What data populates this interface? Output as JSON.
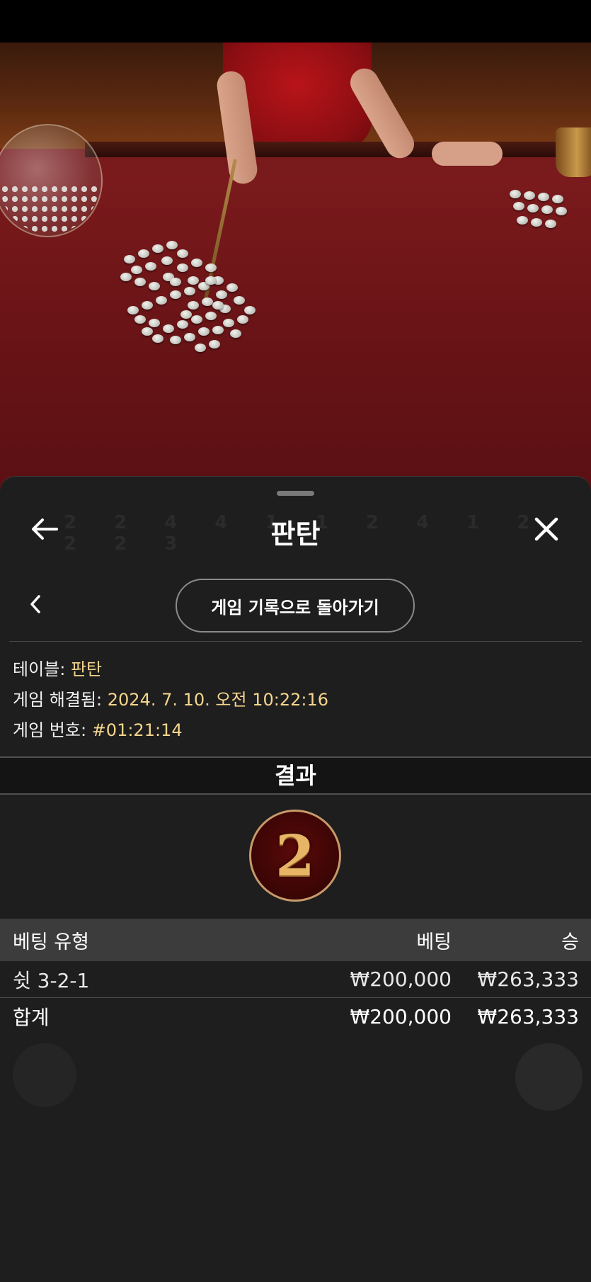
{
  "sheet": {
    "title": "판탄",
    "back_to_history_label": "게임 기록으로 돌아가기"
  },
  "info": {
    "table_label": "테이블:",
    "table_value": "판탄",
    "resolved_label": "게임 해결됨:",
    "resolved_value": "2024. 7. 10. 오전 10:22:16",
    "game_no_label": "게임 번호:",
    "game_no_value": "#01:21:14"
  },
  "result": {
    "heading": "결과",
    "value": "2"
  },
  "bets": {
    "columns": [
      "베팅 유형",
      "베팅",
      "승"
    ],
    "rows": [
      {
        "type": "쉿 3-2-1",
        "bet": "₩200,000",
        "win": "₩263,333"
      }
    ],
    "total": {
      "label": "합계",
      "bet": "₩200,000",
      "win": "₩263,333"
    }
  },
  "icons": {
    "back": "arrow-left-icon",
    "close": "close-icon",
    "prev": "chevron-left-icon"
  },
  "colors": {
    "sheet_bg": "#1e1e1e",
    "value_accent": "#f5d68c",
    "table_header_bg": "#3c3c3c",
    "result_ball_border": "#c79a6a"
  }
}
